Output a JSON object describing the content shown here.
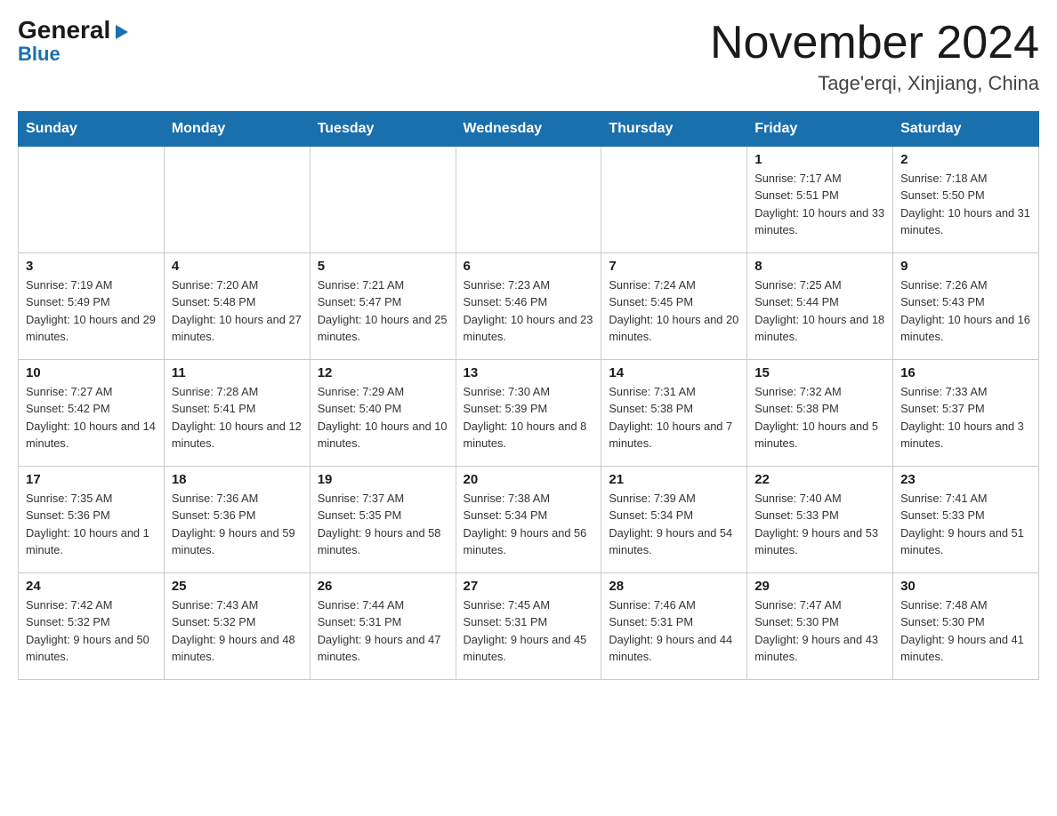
{
  "header": {
    "logo": {
      "general": "General",
      "triangle": "▶",
      "blue": "Blue"
    },
    "title": "November 2024",
    "location": "Tage'erqi, Xinjiang, China"
  },
  "calendar": {
    "days_of_week": [
      "Sunday",
      "Monday",
      "Tuesday",
      "Wednesday",
      "Thursday",
      "Friday",
      "Saturday"
    ],
    "weeks": [
      [
        {
          "day": "",
          "sunrise": "",
          "sunset": "",
          "daylight": ""
        },
        {
          "day": "",
          "sunrise": "",
          "sunset": "",
          "daylight": ""
        },
        {
          "day": "",
          "sunrise": "",
          "sunset": "",
          "daylight": ""
        },
        {
          "day": "",
          "sunrise": "",
          "sunset": "",
          "daylight": ""
        },
        {
          "day": "",
          "sunrise": "",
          "sunset": "",
          "daylight": ""
        },
        {
          "day": "1",
          "sunrise": "Sunrise: 7:17 AM",
          "sunset": "Sunset: 5:51 PM",
          "daylight": "Daylight: 10 hours and 33 minutes."
        },
        {
          "day": "2",
          "sunrise": "Sunrise: 7:18 AM",
          "sunset": "Sunset: 5:50 PM",
          "daylight": "Daylight: 10 hours and 31 minutes."
        }
      ],
      [
        {
          "day": "3",
          "sunrise": "Sunrise: 7:19 AM",
          "sunset": "Sunset: 5:49 PM",
          "daylight": "Daylight: 10 hours and 29 minutes."
        },
        {
          "day": "4",
          "sunrise": "Sunrise: 7:20 AM",
          "sunset": "Sunset: 5:48 PM",
          "daylight": "Daylight: 10 hours and 27 minutes."
        },
        {
          "day": "5",
          "sunrise": "Sunrise: 7:21 AM",
          "sunset": "Sunset: 5:47 PM",
          "daylight": "Daylight: 10 hours and 25 minutes."
        },
        {
          "day": "6",
          "sunrise": "Sunrise: 7:23 AM",
          "sunset": "Sunset: 5:46 PM",
          "daylight": "Daylight: 10 hours and 23 minutes."
        },
        {
          "day": "7",
          "sunrise": "Sunrise: 7:24 AM",
          "sunset": "Sunset: 5:45 PM",
          "daylight": "Daylight: 10 hours and 20 minutes."
        },
        {
          "day": "8",
          "sunrise": "Sunrise: 7:25 AM",
          "sunset": "Sunset: 5:44 PM",
          "daylight": "Daylight: 10 hours and 18 minutes."
        },
        {
          "day": "9",
          "sunrise": "Sunrise: 7:26 AM",
          "sunset": "Sunset: 5:43 PM",
          "daylight": "Daylight: 10 hours and 16 minutes."
        }
      ],
      [
        {
          "day": "10",
          "sunrise": "Sunrise: 7:27 AM",
          "sunset": "Sunset: 5:42 PM",
          "daylight": "Daylight: 10 hours and 14 minutes."
        },
        {
          "day": "11",
          "sunrise": "Sunrise: 7:28 AM",
          "sunset": "Sunset: 5:41 PM",
          "daylight": "Daylight: 10 hours and 12 minutes."
        },
        {
          "day": "12",
          "sunrise": "Sunrise: 7:29 AM",
          "sunset": "Sunset: 5:40 PM",
          "daylight": "Daylight: 10 hours and 10 minutes."
        },
        {
          "day": "13",
          "sunrise": "Sunrise: 7:30 AM",
          "sunset": "Sunset: 5:39 PM",
          "daylight": "Daylight: 10 hours and 8 minutes."
        },
        {
          "day": "14",
          "sunrise": "Sunrise: 7:31 AM",
          "sunset": "Sunset: 5:38 PM",
          "daylight": "Daylight: 10 hours and 7 minutes."
        },
        {
          "day": "15",
          "sunrise": "Sunrise: 7:32 AM",
          "sunset": "Sunset: 5:38 PM",
          "daylight": "Daylight: 10 hours and 5 minutes."
        },
        {
          "day": "16",
          "sunrise": "Sunrise: 7:33 AM",
          "sunset": "Sunset: 5:37 PM",
          "daylight": "Daylight: 10 hours and 3 minutes."
        }
      ],
      [
        {
          "day": "17",
          "sunrise": "Sunrise: 7:35 AM",
          "sunset": "Sunset: 5:36 PM",
          "daylight": "Daylight: 10 hours and 1 minute."
        },
        {
          "day": "18",
          "sunrise": "Sunrise: 7:36 AM",
          "sunset": "Sunset: 5:36 PM",
          "daylight": "Daylight: 9 hours and 59 minutes."
        },
        {
          "day": "19",
          "sunrise": "Sunrise: 7:37 AM",
          "sunset": "Sunset: 5:35 PM",
          "daylight": "Daylight: 9 hours and 58 minutes."
        },
        {
          "day": "20",
          "sunrise": "Sunrise: 7:38 AM",
          "sunset": "Sunset: 5:34 PM",
          "daylight": "Daylight: 9 hours and 56 minutes."
        },
        {
          "day": "21",
          "sunrise": "Sunrise: 7:39 AM",
          "sunset": "Sunset: 5:34 PM",
          "daylight": "Daylight: 9 hours and 54 minutes."
        },
        {
          "day": "22",
          "sunrise": "Sunrise: 7:40 AM",
          "sunset": "Sunset: 5:33 PM",
          "daylight": "Daylight: 9 hours and 53 minutes."
        },
        {
          "day": "23",
          "sunrise": "Sunrise: 7:41 AM",
          "sunset": "Sunset: 5:33 PM",
          "daylight": "Daylight: 9 hours and 51 minutes."
        }
      ],
      [
        {
          "day": "24",
          "sunrise": "Sunrise: 7:42 AM",
          "sunset": "Sunset: 5:32 PM",
          "daylight": "Daylight: 9 hours and 50 minutes."
        },
        {
          "day": "25",
          "sunrise": "Sunrise: 7:43 AM",
          "sunset": "Sunset: 5:32 PM",
          "daylight": "Daylight: 9 hours and 48 minutes."
        },
        {
          "day": "26",
          "sunrise": "Sunrise: 7:44 AM",
          "sunset": "Sunset: 5:31 PM",
          "daylight": "Daylight: 9 hours and 47 minutes."
        },
        {
          "day": "27",
          "sunrise": "Sunrise: 7:45 AM",
          "sunset": "Sunset: 5:31 PM",
          "daylight": "Daylight: 9 hours and 45 minutes."
        },
        {
          "day": "28",
          "sunrise": "Sunrise: 7:46 AM",
          "sunset": "Sunset: 5:31 PM",
          "daylight": "Daylight: 9 hours and 44 minutes."
        },
        {
          "day": "29",
          "sunrise": "Sunrise: 7:47 AM",
          "sunset": "Sunset: 5:30 PM",
          "daylight": "Daylight: 9 hours and 43 minutes."
        },
        {
          "day": "30",
          "sunrise": "Sunrise: 7:48 AM",
          "sunset": "Sunset: 5:30 PM",
          "daylight": "Daylight: 9 hours and 41 minutes."
        }
      ]
    ]
  }
}
